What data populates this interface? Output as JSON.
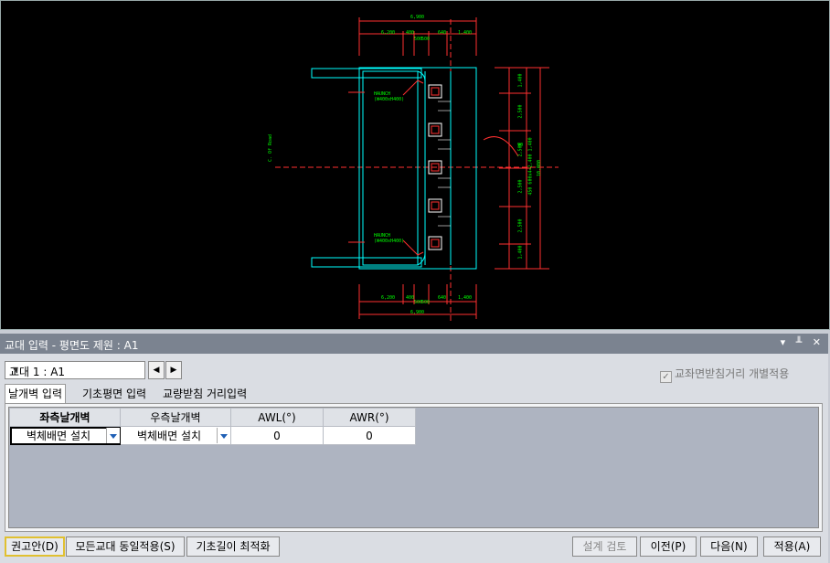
{
  "drawing": {
    "dims_top": [
      "6,900",
      "6,200",
      "400",
      "500",
      "640",
      "1,400",
      "500"
    ],
    "dims_bottom": [
      "6,200",
      "400",
      "500",
      "640",
      "1,400",
      "500",
      "6,900"
    ],
    "dims_right": [
      "1,400",
      "2,500",
      "2,500",
      "2,500",
      "2,500",
      "1,400",
      "450 600x4=2,400 1,400",
      "10,000"
    ],
    "label_axis": "C. Of Road",
    "label_haunch_1": "HAUNCH (W400xH400)",
    "label_haunch_2": "HAUNCH (W400xH400)",
    "angle_label": "90"
  },
  "panel": {
    "title": "교대 입력 - 평면도 제원 : A1",
    "window_buttons": "▾ ╨ ✕"
  },
  "selector": {
    "value": "교대 1 : A1",
    "prev": "◀",
    "next": "▶"
  },
  "checkbox": {
    "label": "교좌면받침거리 개별적용",
    "checked": true
  },
  "tabs": [
    {
      "label": "날개벽 입력"
    },
    {
      "label": "기초평면 입력"
    },
    {
      "label": "교량받침 거리입력"
    }
  ],
  "grid": {
    "headers": [
      "좌측날개벽",
      "우측날개벽",
      "AWL(°)",
      "AWR(°)"
    ],
    "row": [
      "벽체배면 설치",
      "벽체배면 설치",
      "0",
      "0"
    ]
  },
  "buttons": {
    "recommend": "권고안(D)",
    "apply_all": "모든교대 동일적용(S)",
    "optimize": "기초길이 최적화",
    "review": "설계 검토",
    "prev": "이전(P)",
    "next": "다음(N)",
    "apply": "적용(A)"
  }
}
